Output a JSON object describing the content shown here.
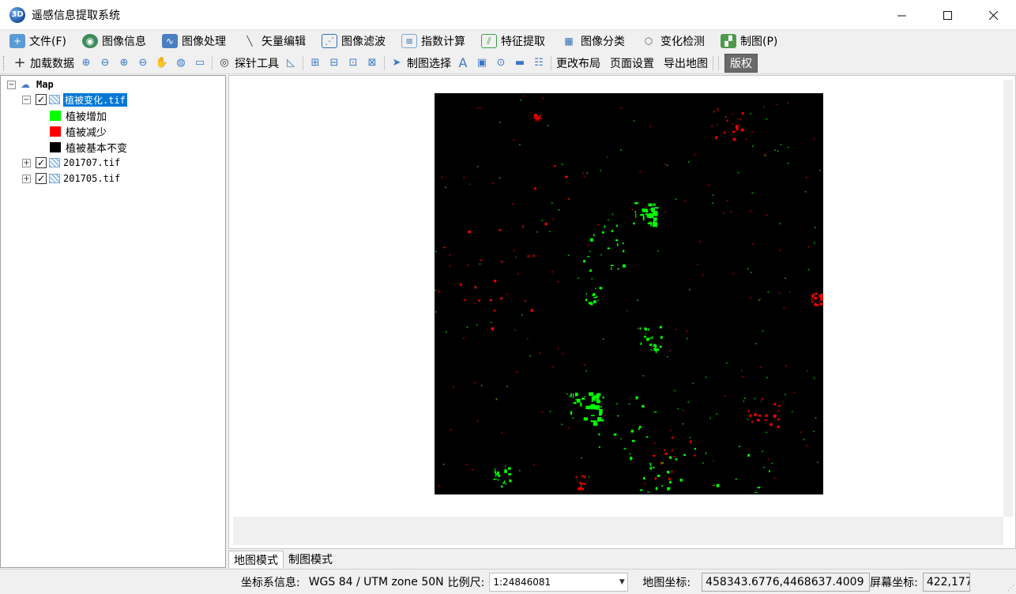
{
  "window": {
    "title": "遥感信息提取系统",
    "app_icon_text": "3D",
    "controls": [
      "minimize",
      "maximize",
      "close"
    ]
  },
  "menu": [
    {
      "label": "文件(F)",
      "icon": "file-icon"
    },
    {
      "label": "图像信息",
      "icon": "image-info-icon"
    },
    {
      "label": "图像处理",
      "icon": "image-process-icon"
    },
    {
      "label": "矢量编辑",
      "icon": "vector-edit-icon"
    },
    {
      "label": "图像滤波",
      "icon": "image-filter-icon"
    },
    {
      "label": "指数计算",
      "icon": "index-calc-icon"
    },
    {
      "label": "特征提取",
      "icon": "feature-extract-icon"
    },
    {
      "label": "图像分类",
      "icon": "image-classify-icon"
    },
    {
      "label": "变化检测",
      "icon": "change-detect-icon"
    },
    {
      "label": "制图(P)",
      "icon": "cartography-icon"
    }
  ],
  "toolbar": {
    "add_data": "加载数据",
    "probe_tool": "探针工具",
    "map_select": "制图选择",
    "change_layout": "更改布局",
    "page_setup": "页面设置",
    "export_map": "导出地图",
    "copyright": "版权"
  },
  "tree": {
    "root": "Map",
    "layers": [
      {
        "name": "植被变化.tif",
        "checked": true,
        "expanded": true,
        "selected": true,
        "legend": [
          {
            "label": "植被增加",
            "color": "#00ff00"
          },
          {
            "label": "植被减少",
            "color": "#ff0000"
          },
          {
            "label": "植被基本不变",
            "color": "#000000"
          }
        ]
      },
      {
        "name": "201707.tif",
        "checked": true,
        "expanded": false
      },
      {
        "name": "201705.tif",
        "checked": true,
        "expanded": false
      }
    ]
  },
  "map": {
    "raster_background": "#000000",
    "increase_color": "#00ff00",
    "decrease_color": "#ff0000"
  },
  "tabs": [
    {
      "label": "地图模式",
      "active": true
    },
    {
      "label": "制图模式",
      "active": false
    }
  ],
  "status": {
    "crs_label": "坐标系信息:",
    "crs_value": "WGS 84 / UTM zone 50N",
    "scale_label": "比例尺:",
    "scale_value": "1:24846081",
    "map_coord_label": "地图坐标:",
    "map_coord_value": "458343.6776,4468637.4009",
    "screen_coord_label": "屏幕坐标:",
    "screen_coord_value": "422,177"
  }
}
